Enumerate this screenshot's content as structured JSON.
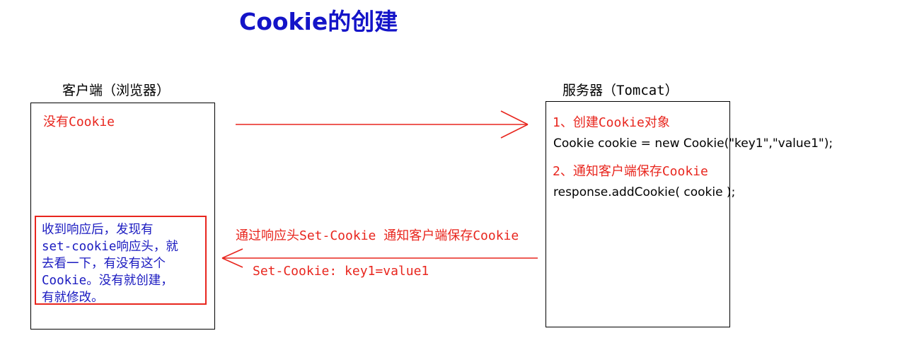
{
  "title": "Cookie的创建",
  "client": {
    "label": "客户端（浏览器）",
    "no_cookie_text": "没有Cookie",
    "note_lines": [
      "收到响应后，发现有",
      "set-cookie响应头，就",
      "去看一下，有没有这个",
      "Cookie。没有就创建，",
      "有就修改。"
    ]
  },
  "server": {
    "label": "服务器（Tomcat）",
    "step1": "1、创建Cookie对象",
    "code1": "Cookie cookie = new Cookie(\"key1\",\"value1\");",
    "step2": "2、通知客户端保存Cookie",
    "code2": "response.addCookie( cookie );"
  },
  "response_arrow": {
    "caption": "通过响应头Set-Cookie 通知客户端保存Cookie",
    "header": "Set-Cookie: key1=value1"
  },
  "colors": {
    "title": "#1414c8",
    "red": "#e8261e",
    "blue": "#1a1ac0",
    "black": "#000000"
  }
}
